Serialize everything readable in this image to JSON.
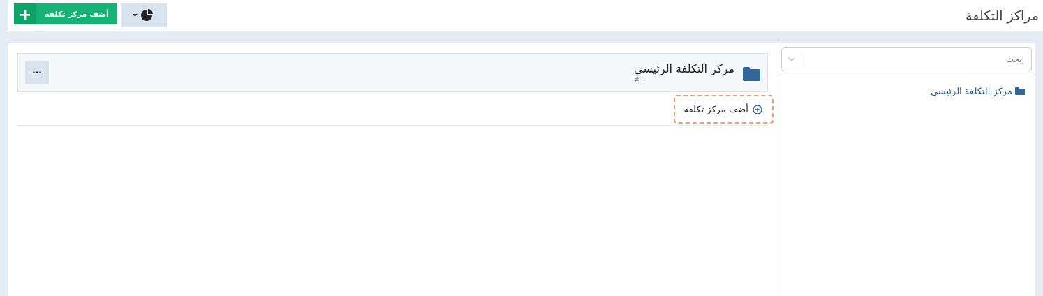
{
  "header": {
    "title": "مراكز التكلفة",
    "add_button": "أضف مركز تكلفة",
    "add_icon": "+"
  },
  "sidebar": {
    "search": {
      "placeholder": "إبحث"
    },
    "tree": [
      {
        "label": "مركز التكلفة الرئيسي",
        "selected": false
      }
    ]
  },
  "main": {
    "card": {
      "title": "مركز التكلفة الرئيسي",
      "number": "#1",
      "menu": "···"
    },
    "add_child": {
      "label": "أضف مركز تكلفة",
      "highlighted": true
    }
  }
}
